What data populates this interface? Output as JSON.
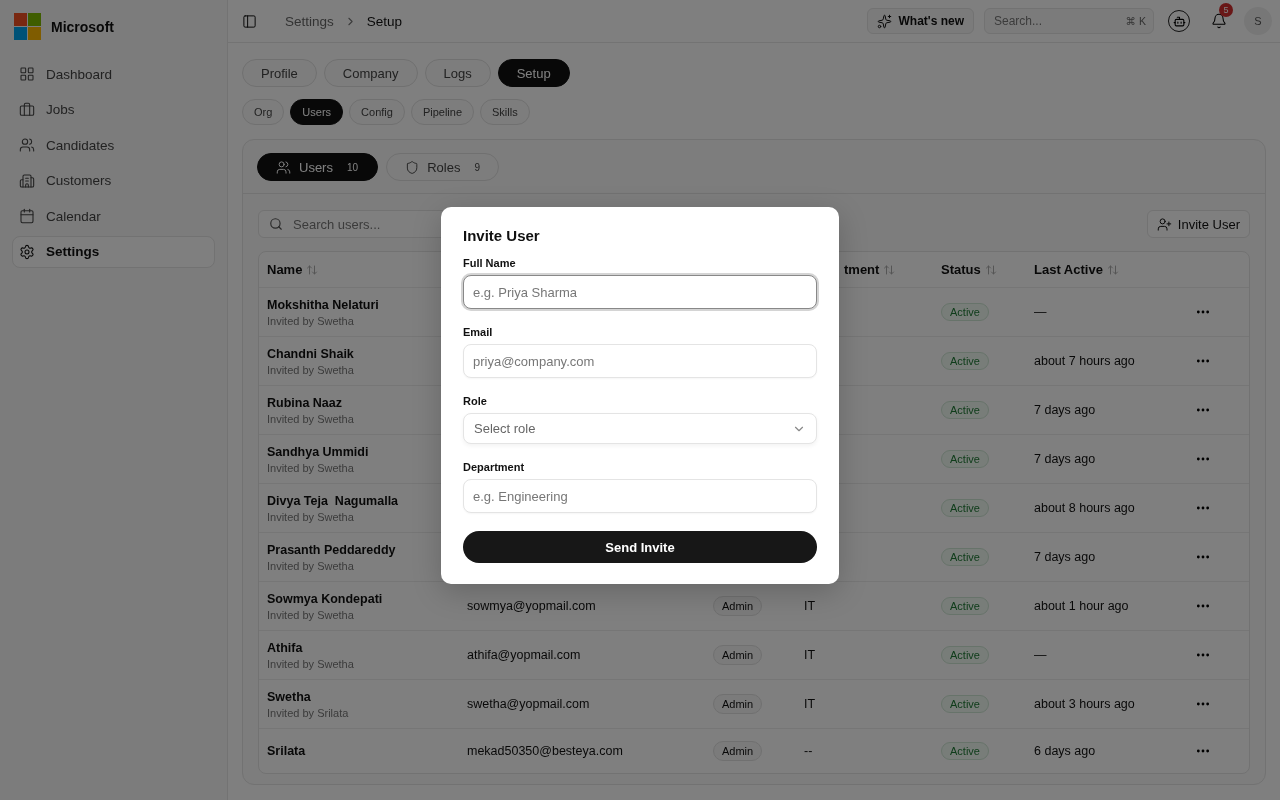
{
  "sidebar": {
    "brand": "Microsoft",
    "items": [
      {
        "label": "Dashboard",
        "selected": false
      },
      {
        "label": "Jobs",
        "selected": false
      },
      {
        "label": "Candidates",
        "selected": false
      },
      {
        "label": "Customers",
        "selected": false
      },
      {
        "label": "Calendar",
        "selected": false
      },
      {
        "label": "Settings",
        "selected": true
      }
    ]
  },
  "topbar": {
    "breadcrumb": [
      "Settings",
      "Setup"
    ],
    "whats_new": "What's new",
    "search": {
      "placeholder": "Search...",
      "shortcut": "⌘ K"
    },
    "notifications": "5",
    "avatar": "S"
  },
  "tabs": [
    {
      "label": "Profile",
      "selected": false
    },
    {
      "label": "Company",
      "selected": false
    },
    {
      "label": "Logs",
      "selected": false
    },
    {
      "label": "Setup",
      "selected": true
    }
  ],
  "subtabs": [
    {
      "label": "Org",
      "selected": false
    },
    {
      "label": "Users",
      "selected": true
    },
    {
      "label": "Config",
      "selected": false
    },
    {
      "label": "Pipeline",
      "selected": false
    },
    {
      "label": "Skills",
      "selected": false
    }
  ],
  "section_tabs": [
    {
      "label": "Users",
      "count": "10",
      "selected": true
    },
    {
      "label": "Roles",
      "count": "9",
      "selected": false
    }
  ],
  "users": {
    "search": {
      "placeholder": "Search users..."
    },
    "invite_button": "Invite User",
    "header": {
      "name": "Name",
      "department": "tment",
      "status": "Status",
      "last_active": "Last Active"
    },
    "rows": [
      {
        "name": "Mokshitha Nelaturi",
        "invited_by": "Invited by Swetha",
        "status": "Active",
        "last_active": "—"
      },
      {
        "name": "Chandni Shaik",
        "invited_by": "Invited by Swetha",
        "status": "Active",
        "last_active": "about 7 hours ago"
      },
      {
        "name": "Rubina Naaz",
        "invited_by": "Invited by Swetha",
        "status": "Active",
        "last_active": "7 days ago"
      },
      {
        "name": "Sandhya Ummidi",
        "invited_by": "Invited by Swetha",
        "status": "Active",
        "last_active": "7 days ago"
      },
      {
        "name": "Divya Teja  Nagumalla",
        "invited_by": "Invited by Swetha",
        "status": "Active",
        "last_active": "about 8 hours ago"
      },
      {
        "name": "Prasanth Peddareddy",
        "invited_by": "Invited by Swetha",
        "status": "Active",
        "last_active": "7 days ago"
      },
      {
        "name": "Sowmya Kondepati",
        "invited_by": "Invited by Swetha",
        "email": "sowmya@yopmail.com",
        "role": "Admin",
        "department": "IT",
        "status": "Active",
        "last_active": "about 1 hour ago"
      },
      {
        "name": "Athifa",
        "invited_by": "Invited by Swetha",
        "email": "athifa@yopmail.com",
        "role": "Admin",
        "department": "IT",
        "status": "Active",
        "last_active": "—"
      },
      {
        "name": "Swetha",
        "invited_by": "Invited by Srilata",
        "email": "swetha@yopmail.com",
        "role": "Admin",
        "department": "IT",
        "status": "Active",
        "last_active": "about 3 hours ago"
      },
      {
        "name": "Srilata",
        "email": "mekad50350@besteya.com",
        "role": "Admin",
        "department": "--",
        "status": "Active",
        "last_active": "6 days ago"
      }
    ]
  },
  "dialog": {
    "title": "Invite User",
    "fields": [
      {
        "kind": "text",
        "label": "Full Name",
        "placeholder": "e.g. Priya Sharma",
        "focused": true
      },
      {
        "kind": "text",
        "label": "Email",
        "placeholder": "priya@company.com",
        "focused": false
      },
      {
        "kind": "select",
        "label": "Role",
        "placeholder": "Select role",
        "focused": false
      },
      {
        "kind": "text",
        "label": "Department",
        "placeholder": "e.g. Engineering",
        "focused": false
      }
    ],
    "submit": "Send Invite"
  }
}
